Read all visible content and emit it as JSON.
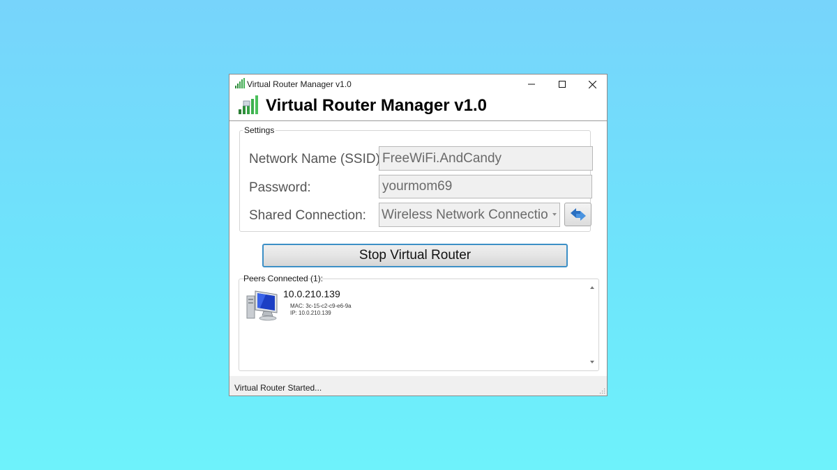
{
  "window": {
    "title": "Virtual Router Manager v1.0"
  },
  "header": {
    "title": "Virtual Router Manager v1.0"
  },
  "settings": {
    "legend": "Settings",
    "ssid_label": "Network Name (SSID):",
    "ssid_value": "FreeWiFi.AndCandy",
    "password_label": "Password:",
    "password_value": "yourmom69",
    "shared_label": "Shared Connection:",
    "shared_value": "Wireless Network Connection"
  },
  "actions": {
    "toggle_label": "Stop Virtual Router"
  },
  "peers": {
    "label": "Peers Connected (1):",
    "items": [
      {
        "name": "10.0.210.139",
        "mac": "MAC: 3c-15-c2-c9-e6-9a",
        "ip": "IP: 10.0.210.139"
      }
    ]
  },
  "status": {
    "text": "Virtual Router Started..."
  },
  "colors": {
    "accent_border": "#3c8fc6",
    "background_top": "#77d4fb",
    "background_bottom": "#6ef2fb"
  },
  "icons": {
    "app": "signal-bars-icon",
    "refresh": "refresh-arrows-icon",
    "peer": "computer-icon"
  }
}
